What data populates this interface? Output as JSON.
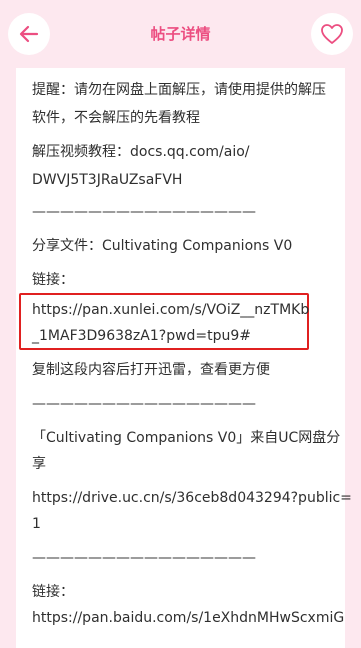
{
  "header": {
    "title": "帖子详情",
    "back_icon": "arrow-left-icon",
    "favorite_icon": "heart-outline-icon",
    "accent_color": "#ec4e81",
    "background_color": "#fde8ef"
  },
  "content": {
    "line1": "提醒：请勿在网盘上面解压，请使用提供的解压",
    "line2": "软件，不会解压的先看教程",
    "line3": "解压视频教程：docs.qq.com/aio/",
    "line4": "DWVJ5T3JRaUZsaFVH",
    "divider1": "————————————————",
    "line5": "分享文件：Cultivating Companions V0",
    "line6": "链接：",
    "link_line1": "https://pan.xunlei.com/s/VOiZ__nzTMKb",
    "link_line2": "_1MAF3D9638zA1?pwd=tpu9#",
    "line7": "复制这段内容后打开迅雷，查看更方便",
    "divider2": "————————————————",
    "line8": "「Cultivating Companions V0」来自UC网盘分",
    "line9": "享",
    "line10": "https://drive.uc.cn/s/36ceb8d043294?public=",
    "line11": "1",
    "divider3": "————————————————",
    "line12": "链接：",
    "line13": "https://pan.baidu.com/s/1eXhdnMHwScxmiG"
  }
}
